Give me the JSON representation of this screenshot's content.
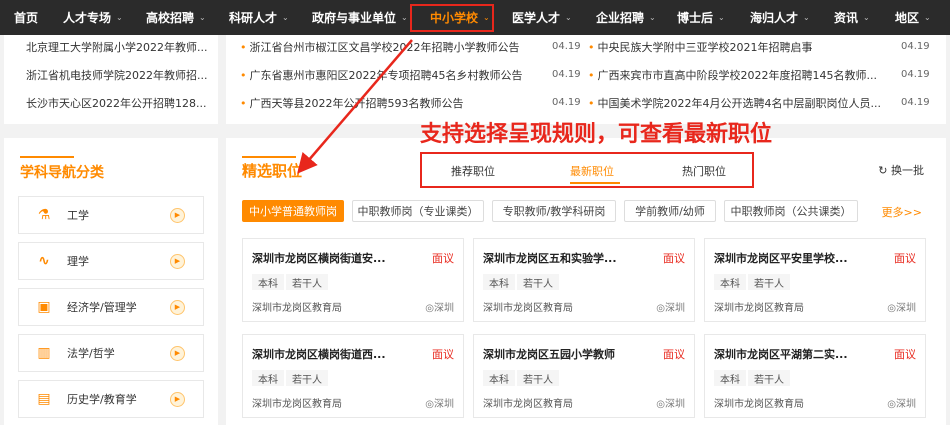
{
  "nav": {
    "items": [
      {
        "label": "首页",
        "has_menu": false
      },
      {
        "label": "人才专场",
        "has_menu": true
      },
      {
        "label": "高校招聘",
        "has_menu": true
      },
      {
        "label": "科研人才",
        "has_menu": true
      },
      {
        "label": "政府与事业单位",
        "has_menu": true
      },
      {
        "label": "中小学校",
        "has_menu": true,
        "active": true
      },
      {
        "label": "医学人才",
        "has_menu": true
      },
      {
        "label": "企业招聘",
        "has_menu": true
      },
      {
        "label": "博士后",
        "has_menu": true
      },
      {
        "label": "海归人才",
        "has_menu": true
      },
      {
        "label": "资讯",
        "has_menu": true
      },
      {
        "label": "地区",
        "has_menu": true
      }
    ]
  },
  "left_news": [
    "北京理工大学附属小学2022年教师...",
    "浙江省机电技师学院2022年教师招...",
    "长沙市天心区2022年公开招聘128..."
  ],
  "mid_news": {
    "col1": [
      {
        "title": "浙江省台州市椒江区文昌学校2022年招聘小学教师公告",
        "date": "04.19"
      },
      {
        "title": "广东省惠州市惠阳区2022年专项招聘45名乡村教师公告",
        "date": "04.19"
      },
      {
        "title": "广西天等县2022年公开招聘593名教师公告",
        "date": "04.19"
      }
    ],
    "col2": [
      {
        "title": "中央民族大学附中三亚学校2021年招聘启事",
        "date": "04.19"
      },
      {
        "title": "广西来宾市市直高中阶段学校2022年度招聘145名教师...",
        "date": "04.19"
      },
      {
        "title": "中国美术学院2022年4月公开选聘4名中层副职岗位人员...",
        "date": "04.19"
      }
    ]
  },
  "categories": {
    "title": "学科导航分类",
    "items": [
      {
        "label": "工学",
        "icon": "flask-icon"
      },
      {
        "label": "理学",
        "icon": "wave-icon"
      },
      {
        "label": "经济学/管理学",
        "icon": "chart-icon"
      },
      {
        "label": "法学/哲学",
        "icon": "bars-icon"
      },
      {
        "label": "历史学/教育学",
        "icon": "book-icon"
      }
    ]
  },
  "main": {
    "title": "精选职位",
    "tabs": [
      "推荐职位",
      "最新职位",
      "热门职位"
    ],
    "active_tab": "最新职位",
    "refresh": "换一批",
    "chips": [
      "中小学普通教师岗",
      "中职教师岗（专业课类）",
      "专职教师/教学科研岗",
      "学前教师/幼师",
      "中职教师岗（公共课类）"
    ],
    "more": "更多>>",
    "jobs": [
      {
        "title": "深圳市龙岗区横岗街道安...",
        "salary": "面议",
        "tags": [
          "本科",
          "若干人"
        ],
        "employer": "深圳市龙岗区教育局",
        "location": "深圳"
      },
      {
        "title": "深圳市龙岗区五和实验学...",
        "salary": "面议",
        "tags": [
          "本科",
          "若干人"
        ],
        "employer": "深圳市龙岗区教育局",
        "location": "深圳"
      },
      {
        "title": "深圳市龙岗区平安里学校...",
        "salary": "面议",
        "tags": [
          "本科",
          "若干人"
        ],
        "employer": "深圳市龙岗区教育局",
        "location": "深圳"
      },
      {
        "title": "深圳市龙岗区横岗街道西...",
        "salary": "面议",
        "tags": [
          "本科",
          "若干人"
        ],
        "employer": "深圳市龙岗区教育局",
        "location": "深圳"
      },
      {
        "title": "深圳市龙岗区五园小学教师",
        "salary": "面议",
        "tags": [
          "本科",
          "若干人"
        ],
        "employer": "深圳市龙岗区教育局",
        "location": "深圳"
      },
      {
        "title": "深圳市龙岗区平湖第二实...",
        "salary": "面议",
        "tags": [
          "本科",
          "若干人"
        ],
        "employer": "深圳市龙岗区教育局",
        "location": "深圳"
      }
    ]
  },
  "annotation": "支持选择呈现规则，可查看最新职位",
  "colors": {
    "accent": "#ff8a00",
    "annotation": "#e8271c",
    "nav_bg": "#2b2b2b"
  }
}
